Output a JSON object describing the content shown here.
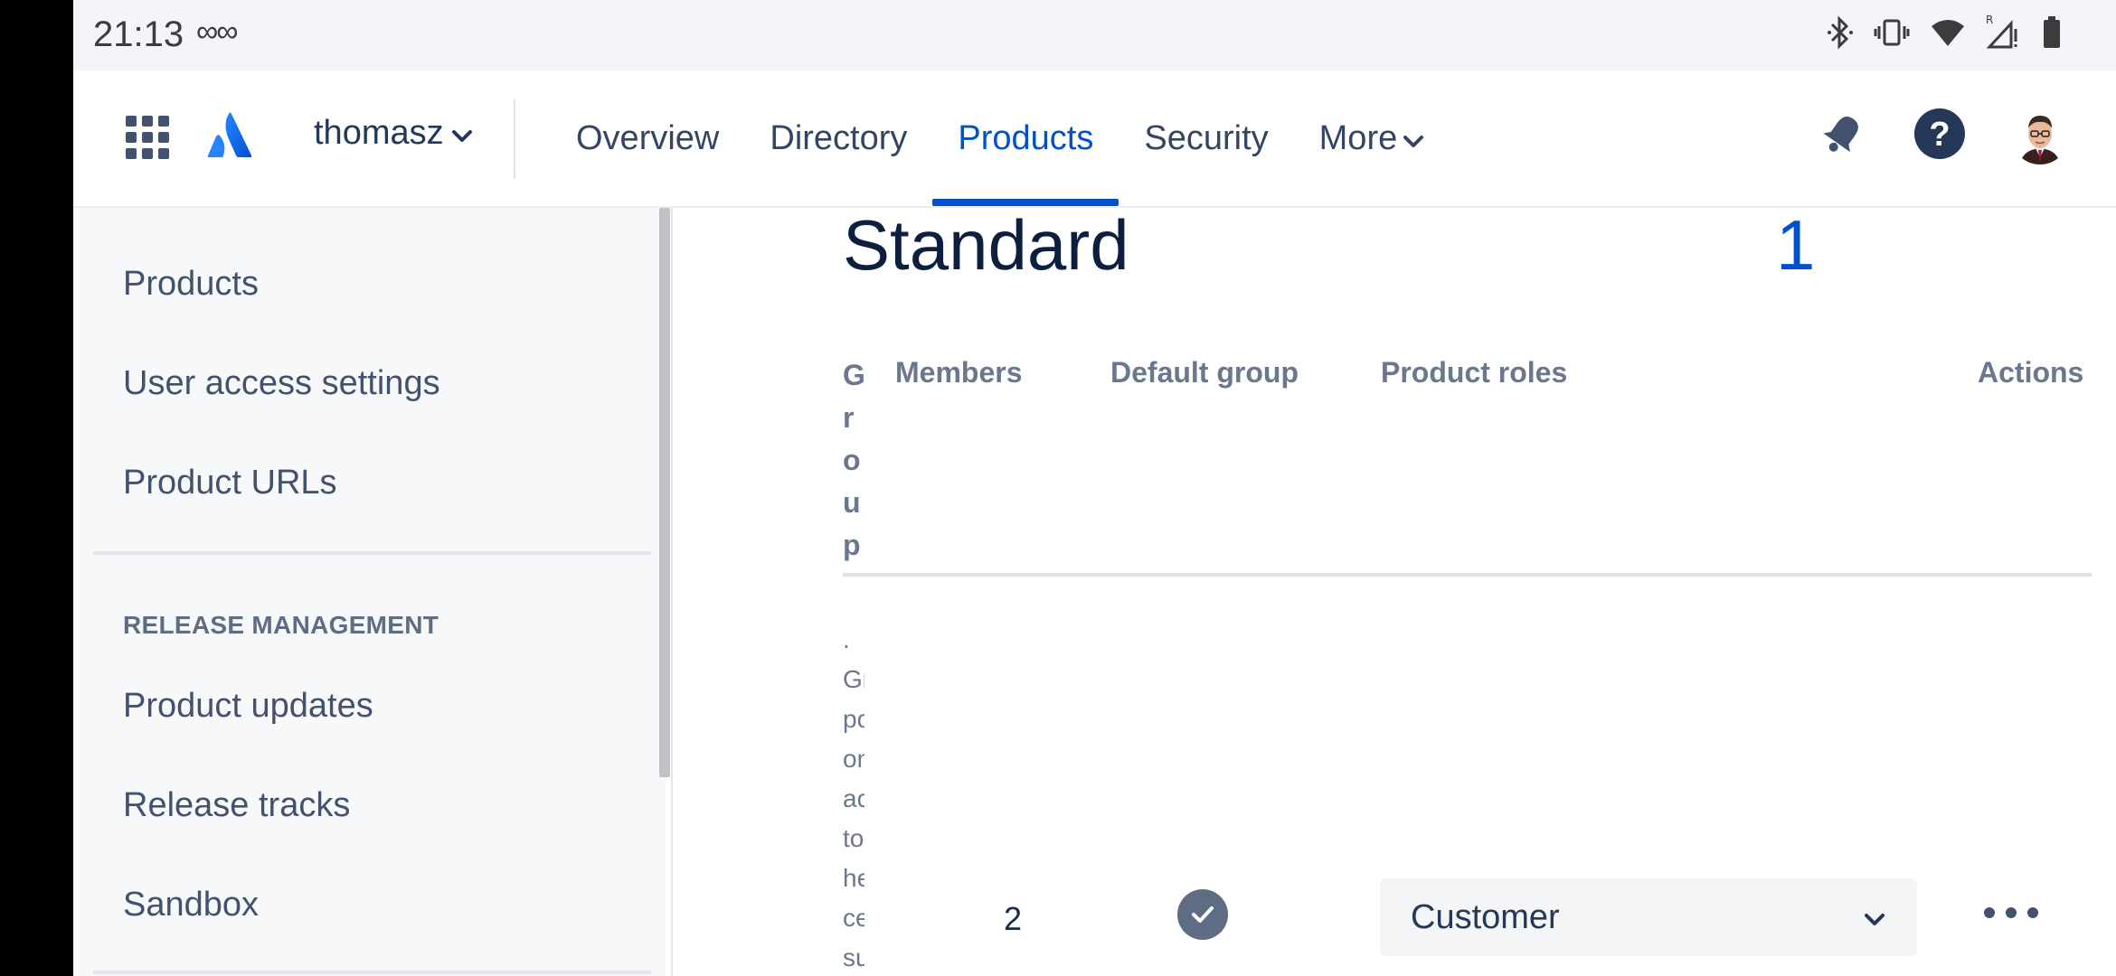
{
  "status_bar": {
    "time": "21:13",
    "infinity_icon": "∞∞"
  },
  "top_nav": {
    "site_name": "thomasz",
    "items": [
      {
        "label": "Overview"
      },
      {
        "label": "Directory"
      },
      {
        "label": "Products"
      },
      {
        "label": "Security"
      },
      {
        "label": "More"
      }
    ],
    "active_item": "Products",
    "accent_color": "#0052CC"
  },
  "sidebar": {
    "items_top": [
      {
        "label": "Products"
      },
      {
        "label": "User access settings"
      },
      {
        "label": "Product URLs"
      }
    ],
    "section_heading": "RELEASE MANAGEMENT",
    "items_release": [
      {
        "label": "Product updates"
      },
      {
        "label": "Release tracks"
      },
      {
        "label": "Sandbox"
      }
    ]
  },
  "main": {
    "title": "Standard",
    "count": "1",
    "table": {
      "headers": {
        "group": "Group",
        "members": "Members",
        "default_group": "Default group",
        "product_roles": "Product roles",
        "actions": "Actions"
      },
      "rows": [
        {
          "description_fragments": ".\nGr\npo\non\nac\nto\nhe\nce\nsu",
          "members": "2",
          "default_group": true,
          "product_role": "Customer"
        }
      ]
    }
  }
}
